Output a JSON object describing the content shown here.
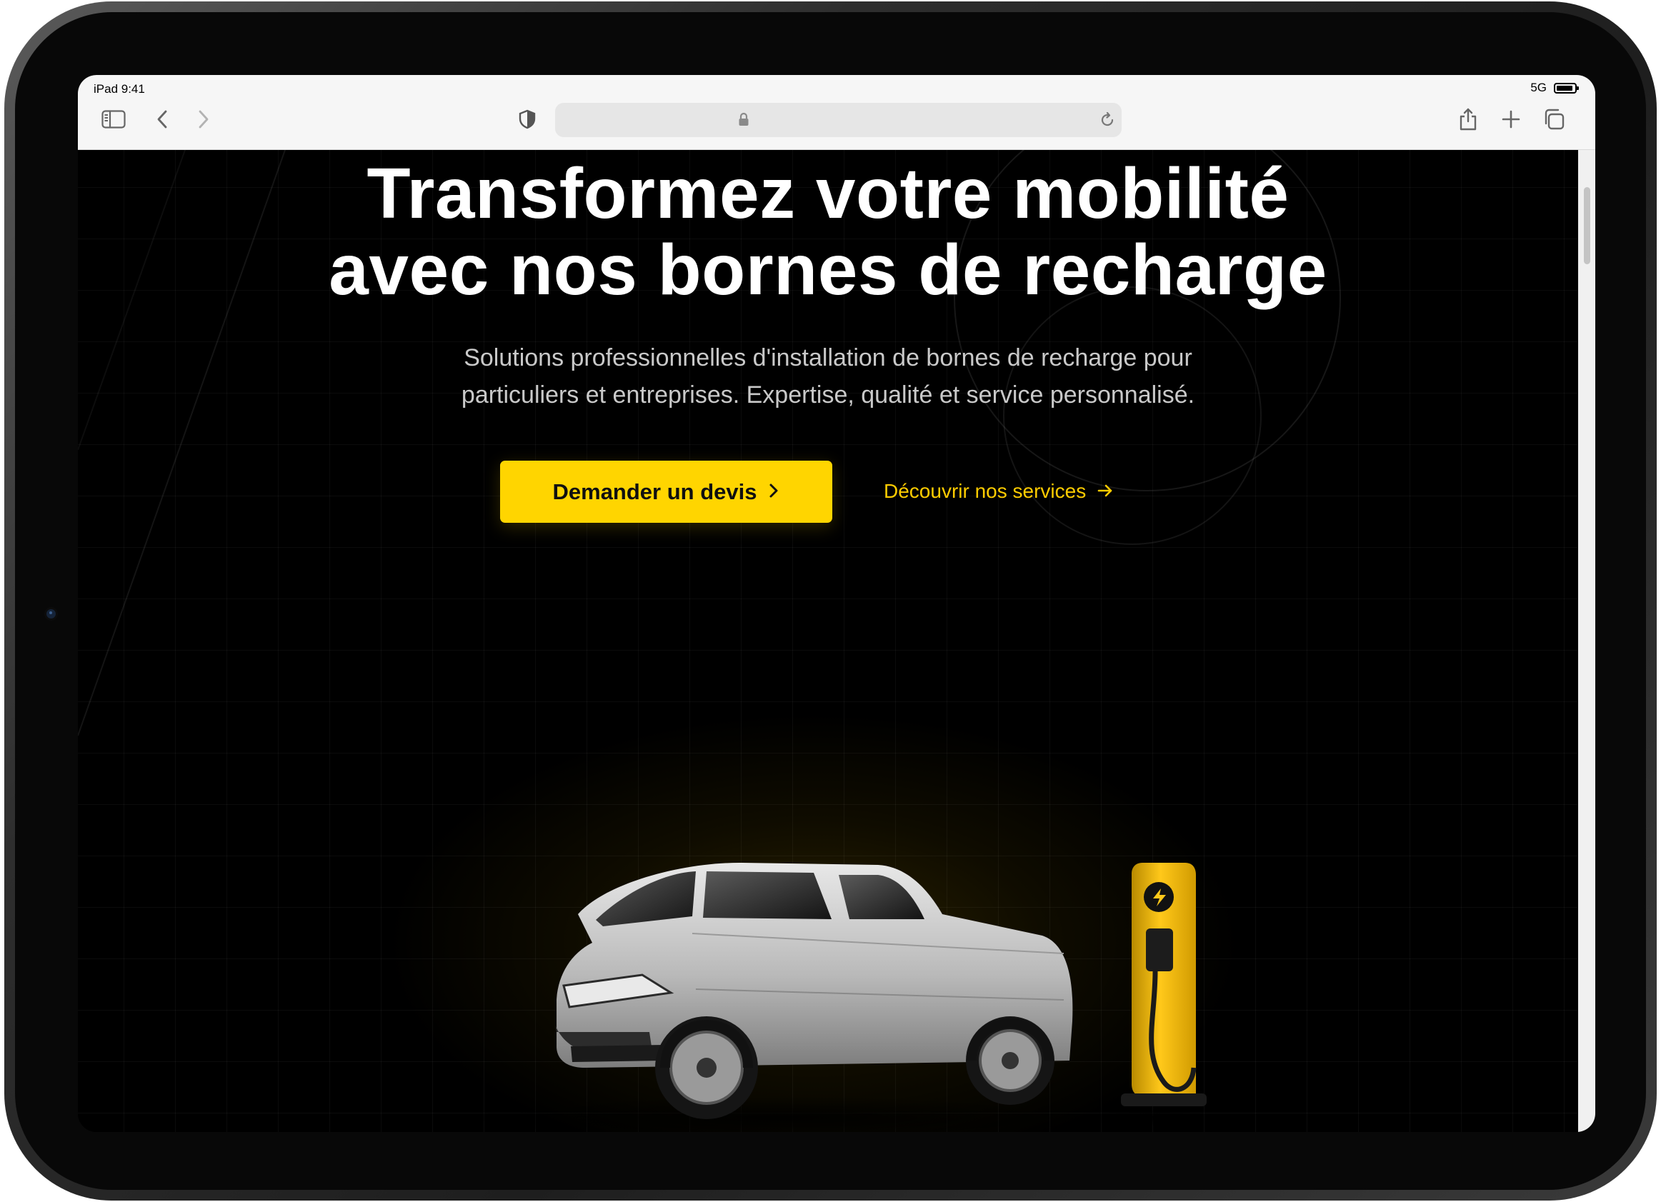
{
  "status_bar": {
    "time": "iPad 9:41",
    "signal": "5G"
  },
  "browser": {
    "sidebar_icon": "sidebar-icon",
    "back_icon": "chevron-left-icon",
    "forward_icon": "chevron-right-icon",
    "privacy_icon": "shield-icon",
    "lock_icon": "lock-icon",
    "reload_icon": "reload-icon",
    "share_icon": "share-icon",
    "new_tab_icon": "plus-icon",
    "tabs_icon": "tabs-icon"
  },
  "hero": {
    "title_line1_part1": "Transformez votre ",
    "title_line1_highlight": "mobilité",
    "title_line2": "avec nos bornes de recharge",
    "subtitle_line1": "Solutions professionnelles d'installation de bornes de recharge pour",
    "subtitle_line2": "particuliers et entreprises. Expertise, qualité et service personnalisé.",
    "primary_cta": "Demander un devis",
    "secondary_cta": "Découvrir nos services",
    "illustration": "electric-suv-with-charging-station"
  },
  "colors": {
    "accent": "#ffd500",
    "background": "#000000",
    "text": "#ffffff",
    "muted_text": "#c9c9c9"
  }
}
